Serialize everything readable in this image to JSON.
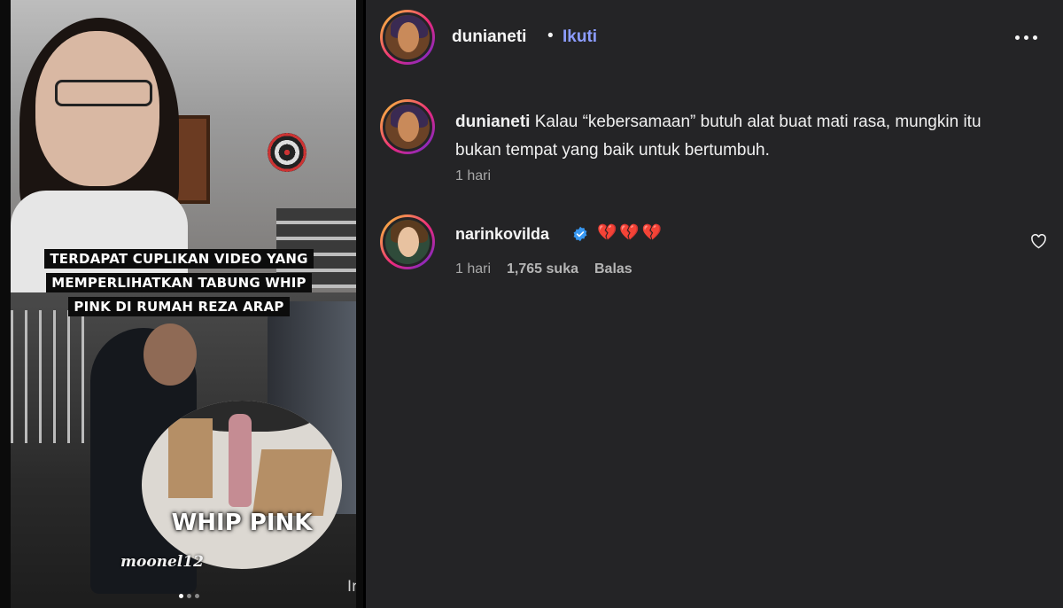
{
  "post_media": {
    "overlay_caption": "TERDAPAT CUPLIKAN VIDEO YANG MEMPERLIHATKAN TABUNG WHIP PINK DI RUMAH REZA ARAP",
    "caption_lines": [
      "TERDAPAT CUPLIKAN VIDEO YANG",
      "MEMPERLIHATKAN TABUNG WHIP",
      "PINK DI RUMAH REZA ARAP"
    ],
    "inset_label": "WHIP PINK",
    "watermark": "moonel12",
    "platform_mark": "InS",
    "carousel_dots": 3,
    "carousel_active": 1
  },
  "header": {
    "username": "dunianeti",
    "separator": "•",
    "follow_label": "Ikuti",
    "more_icon": "more-horizontal-icon"
  },
  "post_caption": {
    "username": "dunianeti",
    "text": "Kalau “kebersamaan” butuh alat buat mati rasa, mungkin itu bukan tempat yang baik untuk bertumbuh.",
    "time": "1 hari"
  },
  "comments": [
    {
      "username": "narinkovilda",
      "verified": true,
      "text": "💔💔💔",
      "time": "1 hari",
      "likes": "1,765 suka",
      "reply_label": "Balas",
      "like_icon": "heart-outline-icon"
    }
  ],
  "colors": {
    "panel_bg": "#242426",
    "link_blue": "#8c9cff",
    "verified_blue": "#3897f0",
    "muted_text": "#a8a8a8"
  }
}
